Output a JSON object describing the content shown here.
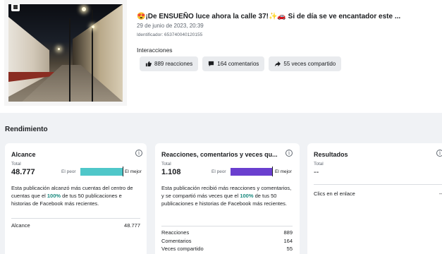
{
  "post": {
    "title": "😍¡De ENSUEÑO luce ahora la calle 37!✨🚗 Si de día se ve encantador este ...",
    "date": "29 de junio de 2023, 20:39",
    "id": "Identificador: 653740040120155",
    "interactions_label": "Interacciones",
    "chips": [
      {
        "icon": "thumbs-up-icon",
        "label": "889 reacciones"
      },
      {
        "icon": "comment-icon",
        "label": "164 comentarios"
      },
      {
        "icon": "share-icon",
        "label": "55 veces compartido"
      }
    ]
  },
  "section_title": "Rendimiento",
  "cards": {
    "reach": {
      "title": "Alcance",
      "total_label": "Total",
      "total_value": "48.777",
      "worst": "El peor",
      "best": "El mejor",
      "bar_color": "#4fc7c9",
      "description_1": "Esta publicación alcanzó más cuentas del centro de cuentas que el ",
      "description_pct": "100%",
      "description_2": " de tus 50 publicaciones e historias de Facebook más recientes.",
      "rows": [
        {
          "label": "Alcance",
          "value": "48.777"
        }
      ]
    },
    "engagement": {
      "title": "Reacciones, comentarios y veces qu...",
      "total_label": "Total",
      "total_value": "1.108",
      "worst": "El peor",
      "best": "El mejor",
      "bar_color": "#6a3fcf",
      "description_1": "Esta publicación recibió más reacciones y comentarios, y se compartió más veces que el ",
      "description_pct": "100%",
      "description_2": " de tus 50 publicaciones e historias de Facebook más recientes.",
      "rows": [
        {
          "label": "Reacciones",
          "value": "889"
        },
        {
          "label": "Comentarios",
          "value": "164"
        },
        {
          "label": "Veces compartido",
          "value": "55"
        }
      ]
    },
    "results": {
      "title": "Resultados",
      "total_label": "Total",
      "total_value": "--",
      "rows": [
        {
          "label": "Clics en el enlace",
          "value": "--"
        }
      ]
    }
  }
}
